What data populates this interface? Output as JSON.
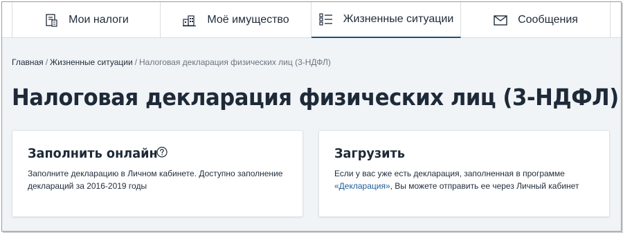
{
  "nav": {
    "items": [
      {
        "label": "Мои налоги",
        "icon": "tax-document-icon"
      },
      {
        "label": "Моё имущество",
        "icon": "property-icon"
      },
      {
        "label": "Жизненные ситуации",
        "icon": "list-icon"
      },
      {
        "label": "Сообщения",
        "icon": "envelope-icon"
      }
    ],
    "active_index": 2
  },
  "breadcrumb": {
    "home": "Главная",
    "separator": "/",
    "section": "Жизненные ситуации",
    "current": "Налоговая декларация физических лиц (3-НДФЛ)"
  },
  "page_title": "Налоговая декларация физических лиц (3-НДФЛ)",
  "cards": {
    "online": {
      "title": "Заполнить онлайн",
      "help_icon": "help-icon",
      "text": "Заполните декларацию в Личном кабинете. Доступно заполнение деклараций за 2016-2019 годы"
    },
    "upload": {
      "title": "Загрузить",
      "text_before": "Если у вас уже есть декларация, заполненная в программе ",
      "link": "«Декларация»",
      "text_after": ", Вы можете отправить ее через Личный кабинет"
    }
  },
  "colors": {
    "text": "#1e2a38",
    "link": "#1f5c99",
    "active_tab_underline": "#1f4e79",
    "background": "#f0f4f7"
  }
}
